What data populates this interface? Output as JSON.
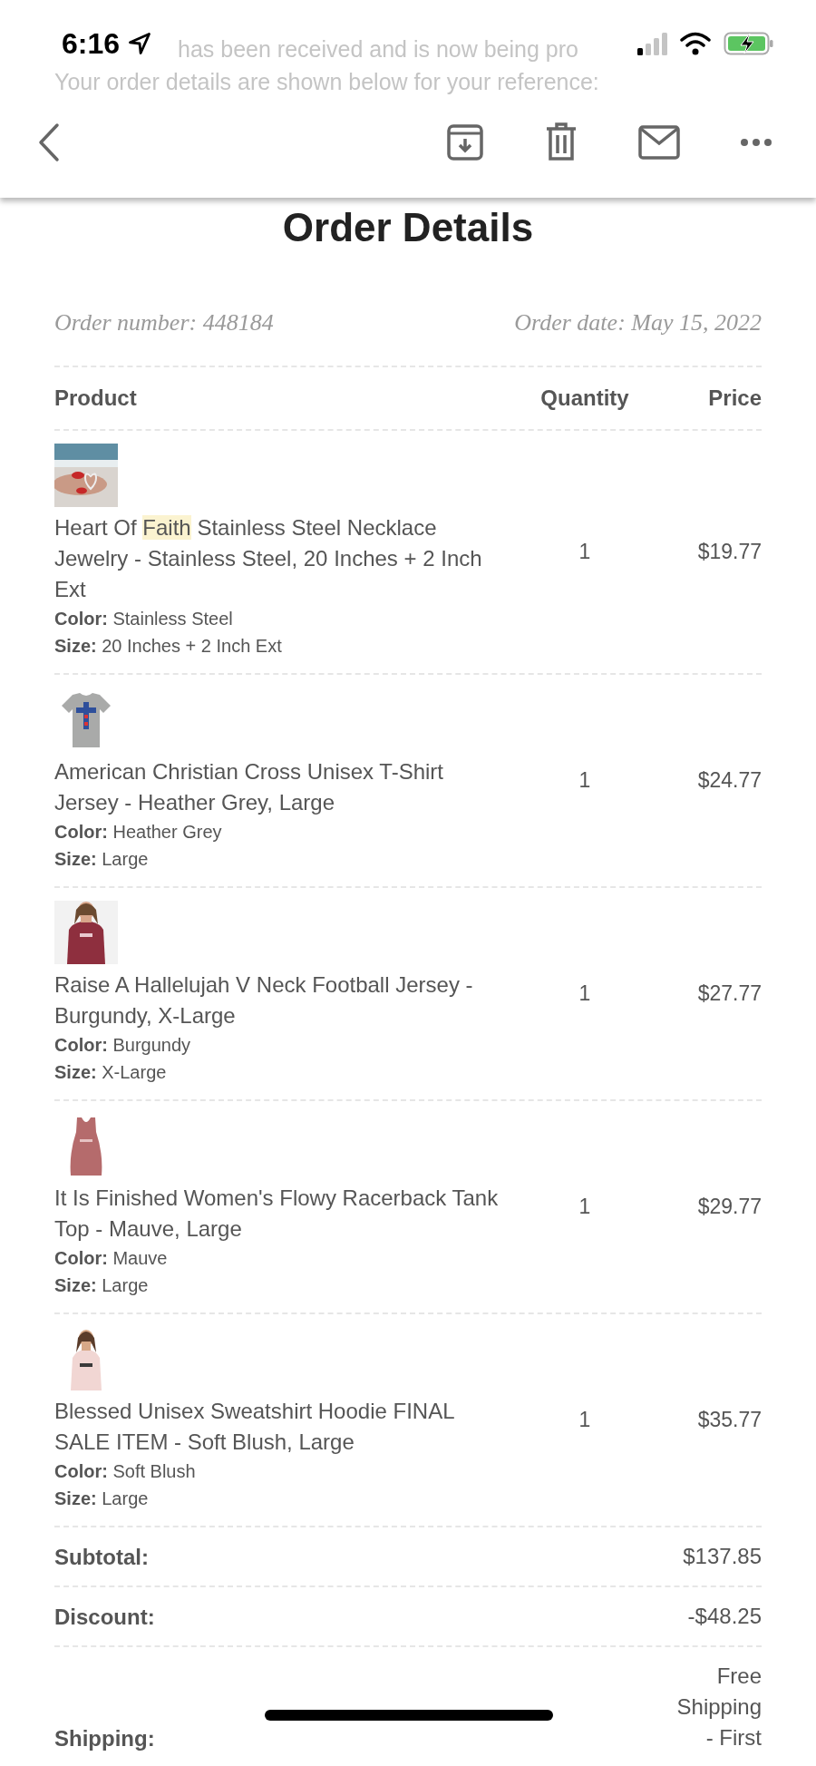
{
  "status_bar": {
    "time": "6:16"
  },
  "background_text": [
    "has been received and is now being pro",
    "Your order details are shown below for your reference:"
  ],
  "title": "Order Details",
  "order_number": "Order number: 448184",
  "order_date": "Order date: May 15, 2022",
  "table": {
    "columns": [
      "Product",
      "Quantity",
      "Price"
    ],
    "rows": [
      {
        "picture": {
          "kind": "picture"
        },
        "name": [
          {
            "text": "Heart Of ",
            "highlighted": false
          },
          {
            "text": "Faith",
            "highlighted": true
          },
          {
            "text": " Stainless Steel Necklace Jewelry - Stainless Steel, 20 Inches + 2 Inch Ext",
            "highlighted": false
          }
        ],
        "color_label": "Color:",
        "color_text": "Stainless Steel",
        "size_label": "Size:",
        "size": "20 Inches + 2 Inch Ext",
        "quantity": "1",
        "price": "$19.77"
      },
      {
        "picture": {
          "kind": "picture"
        },
        "name": [
          {
            "text": "American Christian Cross Unisex T-Shirt Jersey - Heather Grey, Large",
            "highlighted": false
          }
        ],
        "color_label": "Color:",
        "color_text": "Heather Grey",
        "size_label": "Size:",
        "size": "Large",
        "quantity": "1",
        "price": "$24.77"
      },
      {
        "picture": {
          "kind": "picture"
        },
        "name": [
          {
            "text": "Raise A Hallelujah V Neck Football Jersey - Burgundy, X-Large",
            "highlighted": false
          }
        ],
        "color_label": "Color:",
        "color_text": "Burgundy",
        "size_label": "Size:",
        "size": "X-Large",
        "quantity": "1",
        "price": "$27.77"
      },
      {
        "picture": {
          "kind": "picture"
        },
        "name": [
          {
            "text": "It Is Finished Women's Flowy Racerback Tank Top - Mauve, Large",
            "highlighted": false
          }
        ],
        "color_label": "Color:",
        "color_text": "Mauve",
        "size_label": "Size:",
        "size": "Large",
        "quantity": "1",
        "price": "$29.77"
      },
      {
        "picture": {
          "kind": "picture"
        },
        "name": [
          {
            "text": "Blessed Unisex Sweatshirt Hoodie FINAL SALE ITEM - Soft Blush, Large",
            "highlighted": false
          }
        ],
        "color_label": "Color:",
        "color_text": "Soft Blush",
        "size_label": "Size:",
        "size": "Large",
        "quantity": "1",
        "price": "$35.77"
      }
    ]
  },
  "totals": [
    {
      "label": "Subtotal:",
      "value": "$137.85"
    },
    {
      "label": "Discount:",
      "value": "-$48.25"
    },
    {
      "label": "Shipping:",
      "value": "Free Shipping - First"
    }
  ]
}
